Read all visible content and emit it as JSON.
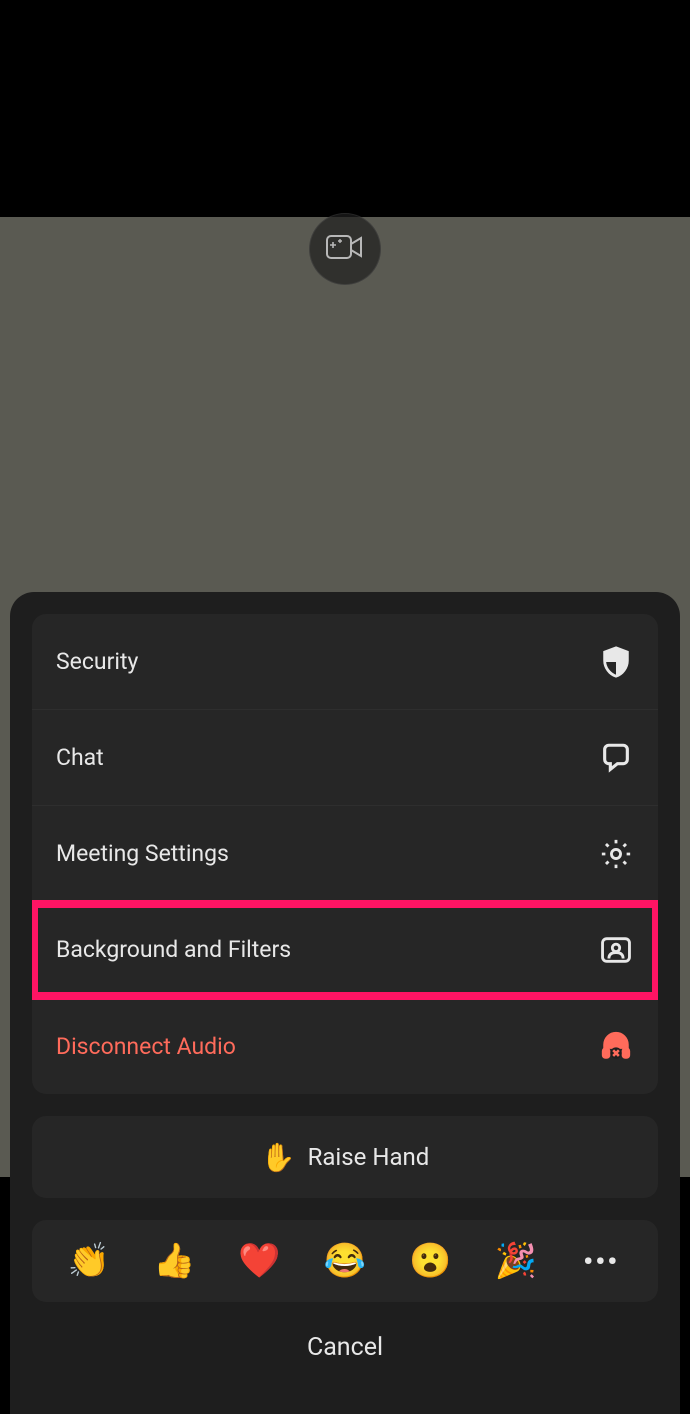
{
  "menu": {
    "items": [
      {
        "label": "Security",
        "icon": "shield-icon"
      },
      {
        "label": "Chat",
        "icon": "chat-icon"
      },
      {
        "label": "Meeting Settings",
        "icon": "gear-icon"
      },
      {
        "label": "Background and Filters",
        "icon": "person-frame-icon",
        "highlighted": true
      },
      {
        "label": "Disconnect Audio",
        "icon": "headphones-x-icon",
        "danger": true
      }
    ]
  },
  "raise_hand": {
    "emoji": "✋",
    "label": "Raise Hand"
  },
  "reactions": [
    "👏",
    "👍",
    "❤️",
    "😂",
    "😮",
    "🎉"
  ],
  "cancel_label": "Cancel",
  "colors": {
    "highlight": "#ff1464",
    "danger": "#ff6b5b",
    "sheet_bg": "#1e1e1e",
    "item_bg": "#262626"
  }
}
